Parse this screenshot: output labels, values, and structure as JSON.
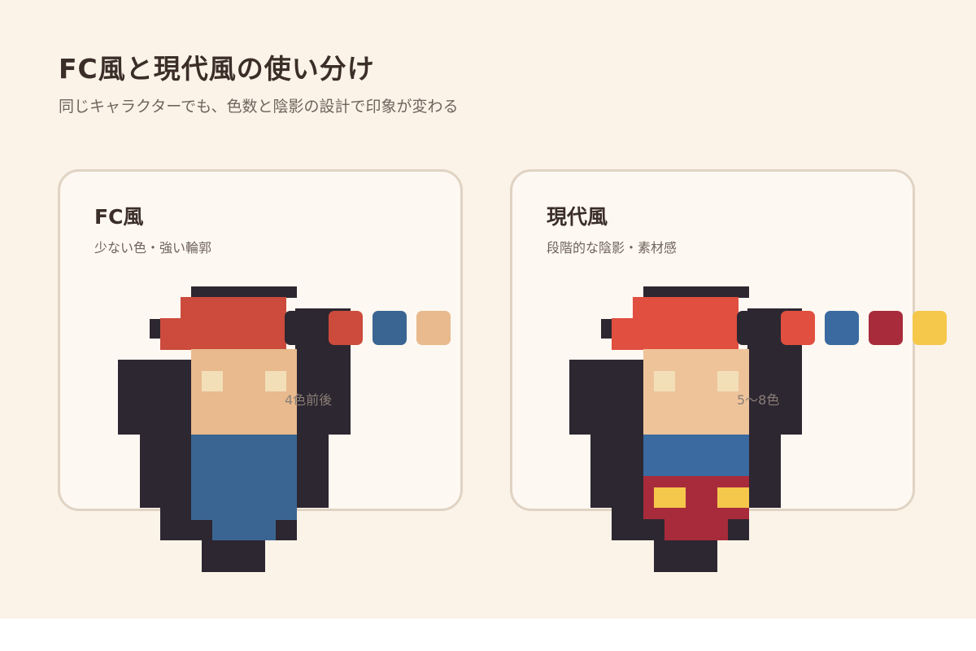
{
  "page": {
    "title": "FC風と現代風の使い分け",
    "subtitle": "同じキャラクターでも、色数と陰影の設計で印象が変わる"
  },
  "cards": [
    {
      "title": "FC風",
      "description": "少ない色・強い輪郭",
      "color_count_label": "4色前後",
      "palette": [
        "#2d2731",
        "#cc4b3c",
        "#3a6592",
        "#e8ba8e"
      ],
      "colors": {
        "outline": "#2d2731",
        "hat": "#cc4b3c",
        "skin": "#e8ba8e",
        "eyes": "#f2dfb8",
        "body": "#3a6592"
      }
    },
    {
      "title": "現代風",
      "description": "段階的な陰影・素材感",
      "color_count_label": "5〜8色",
      "palette": [
        "#2d2731",
        "#e04f3f",
        "#3a6aa0",
        "#a82b3b",
        "#f5c84b"
      ],
      "colors": {
        "outline": "#2d2731",
        "hat": "#e04f3f",
        "skin": "#efc39a",
        "eyes": "#f2dfb8",
        "body": "#3a6aa0",
        "pants": "#a82b3b",
        "buttons": "#f5c84b"
      }
    }
  ]
}
